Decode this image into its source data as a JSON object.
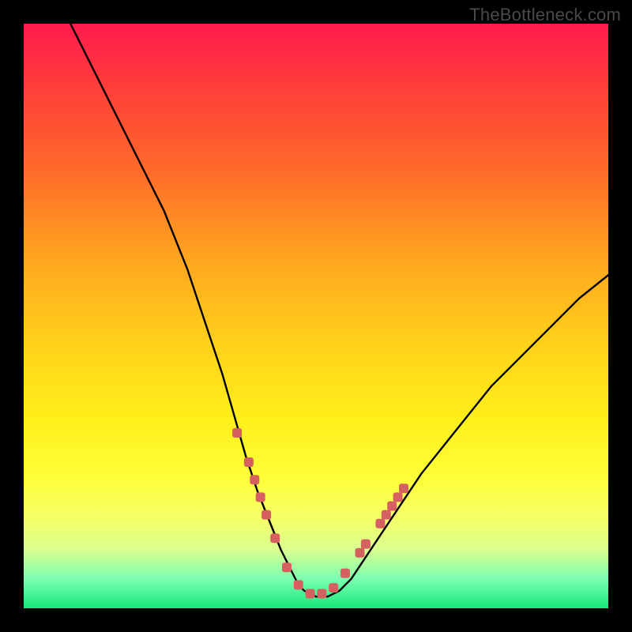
{
  "watermark": "TheBottleneck.com",
  "chart_data": {
    "type": "line",
    "title": "",
    "xlabel": "",
    "ylabel": "",
    "xlim": [
      0,
      100
    ],
    "ylim": [
      0,
      100
    ],
    "curve": {
      "name": "bottleneck-curve",
      "x": [
        8,
        12,
        16,
        20,
        24,
        28,
        30,
        32,
        34,
        36,
        38,
        40,
        42,
        44,
        46,
        47,
        48,
        50,
        52,
        54,
        56,
        58,
        60,
        64,
        68,
        72,
        76,
        80,
        85,
        90,
        95,
        100
      ],
      "y": [
        100,
        92,
        84,
        76,
        68,
        58,
        52,
        46,
        40,
        33,
        26,
        20,
        15,
        10,
        6,
        4,
        3,
        2,
        2,
        3,
        5,
        8,
        11,
        17,
        23,
        28,
        33,
        38,
        43,
        48,
        53,
        57
      ]
    },
    "markers": {
      "name": "sample-points",
      "color": "#d66060",
      "x": [
        36.5,
        38.5,
        39.5,
        40.5,
        41.5,
        43.0,
        45.0,
        47.0,
        49.0,
        51.0,
        53.0,
        55.0,
        57.5,
        58.5,
        61.0,
        62.0,
        63.0,
        64.0,
        65.0
      ],
      "y": [
        30.0,
        25.0,
        22.0,
        19.0,
        16.0,
        12.0,
        7.0,
        4.0,
        2.5,
        2.5,
        3.5,
        6.0,
        9.5,
        11.0,
        14.5,
        16.0,
        17.5,
        19.0,
        20.5
      ]
    }
  }
}
